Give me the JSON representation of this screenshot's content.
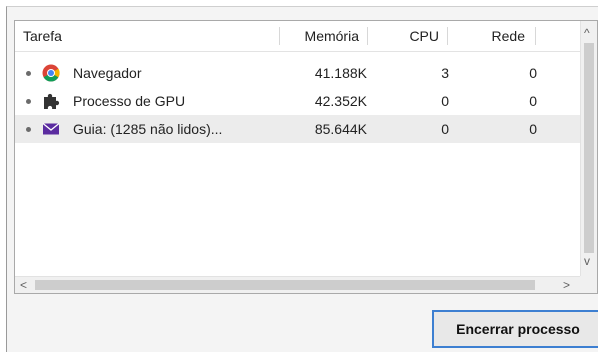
{
  "columns": {
    "task": "Tarefa",
    "memory": "Memória",
    "cpu": "CPU",
    "network": "Rede"
  },
  "rows": [
    {
      "name": "Navegador",
      "memory": "41.188K",
      "cpu": "3",
      "network": "0",
      "icon": "chrome-icon"
    },
    {
      "name": "Processo de GPU",
      "memory": "42.352K",
      "cpu": "0",
      "network": "0",
      "icon": "puzzle-icon"
    },
    {
      "name": "Guia: (1285 não lidos)...",
      "memory": "85.644K",
      "cpu": "0",
      "network": "0",
      "icon": "mail-icon"
    }
  ],
  "scroll": {
    "up_arrow": "^",
    "down_arrow": "v",
    "left_arrow": "<",
    "right_arrow": ">"
  },
  "end_process_label": "Encerrar processo",
  "colors": {
    "button_border": "#3d7fd1",
    "selected_row": "#ececec",
    "mail_icon": "#5b2ca0"
  }
}
